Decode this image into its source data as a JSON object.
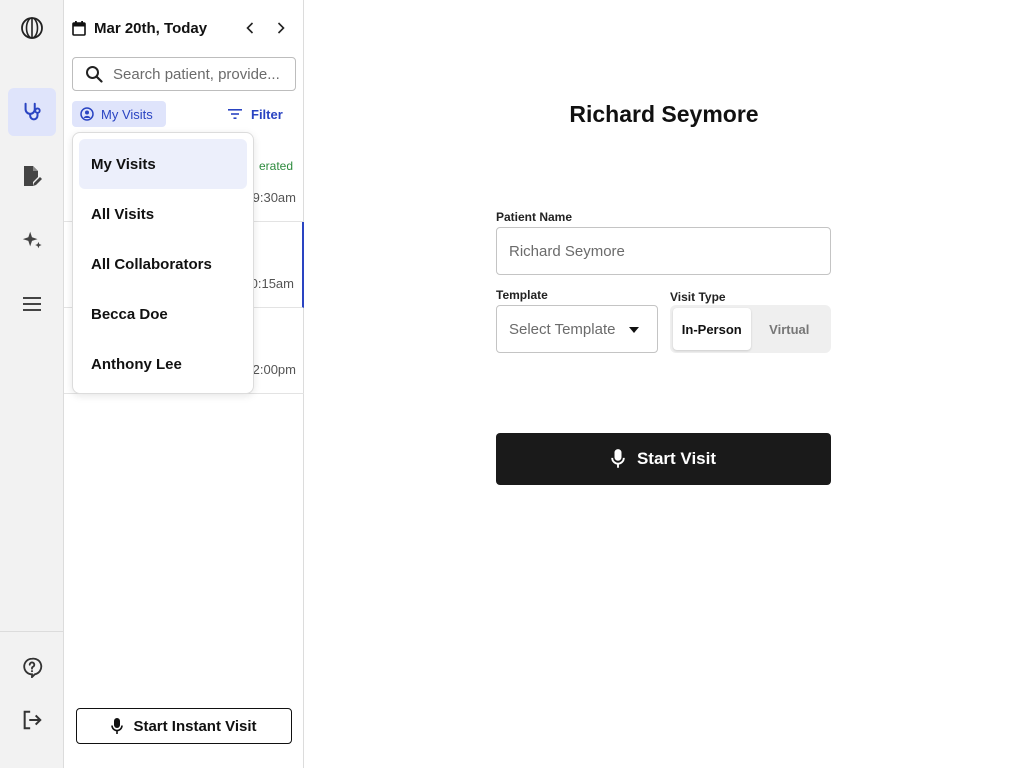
{
  "rail": {
    "items": [
      {
        "name": "logo-icon"
      },
      {
        "name": "stethoscope-icon",
        "active": true
      },
      {
        "name": "document-edit-icon"
      },
      {
        "name": "sparkle-icon"
      },
      {
        "name": "menu-icon"
      },
      {
        "name": "help-icon"
      },
      {
        "name": "logout-icon"
      }
    ]
  },
  "panel": {
    "date_label": "Mar 20th, Today",
    "search_placeholder": "Search patient, provide...",
    "scope_chip": "My Visits",
    "filter_label": "Filter",
    "visits": [
      {
        "status": "erated",
        "time": "9:30am"
      },
      {
        "status": "",
        "time": "0:15am",
        "selected": true
      },
      {
        "status": "",
        "time": "2:00pm"
      }
    ],
    "instant_visit_label": "Start Instant Visit"
  },
  "dropdown": {
    "options": [
      "My Visits",
      "All Visits",
      "All Collaborators",
      "Becca Doe",
      "Anthony Lee"
    ],
    "selected": "My Visits"
  },
  "main": {
    "patient_title": "Richard Seymore",
    "patient_name_label": "Patient Name",
    "patient_name_placeholder": "Richard Seymore",
    "template_label": "Template",
    "template_placeholder": "Select Template",
    "visit_type_label": "Visit Type",
    "visit_types": [
      "In-Person",
      "Virtual"
    ],
    "visit_type_selected": "In-Person",
    "start_button_label": "Start Visit"
  },
  "colors": {
    "accent": "#2a44c2",
    "accent_bg": "#dfe4fb",
    "status_green": "#2e8b3e",
    "primary_button": "#1a1a1a"
  }
}
